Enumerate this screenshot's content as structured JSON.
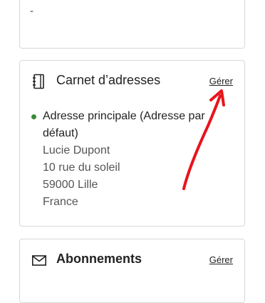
{
  "top_card": {
    "value": "-"
  },
  "address_book": {
    "title": "Carnet d’adresses",
    "manage_label": "Gérer",
    "icon": "address-book-icon",
    "primary_address": {
      "heading": "Adresse principale (Adresse par défaut)",
      "name": "Lucie Dupont",
      "street": "10 rue du soleil",
      "city": "59000 Lille",
      "country": "France"
    },
    "status_color": "#3a8a3a"
  },
  "subscriptions": {
    "title": "Abonnements",
    "manage_label": "Gérer",
    "icon": "envelope-icon"
  },
  "annotation": {
    "color": "#e8141c",
    "icon": "red-arrow-annotation"
  }
}
